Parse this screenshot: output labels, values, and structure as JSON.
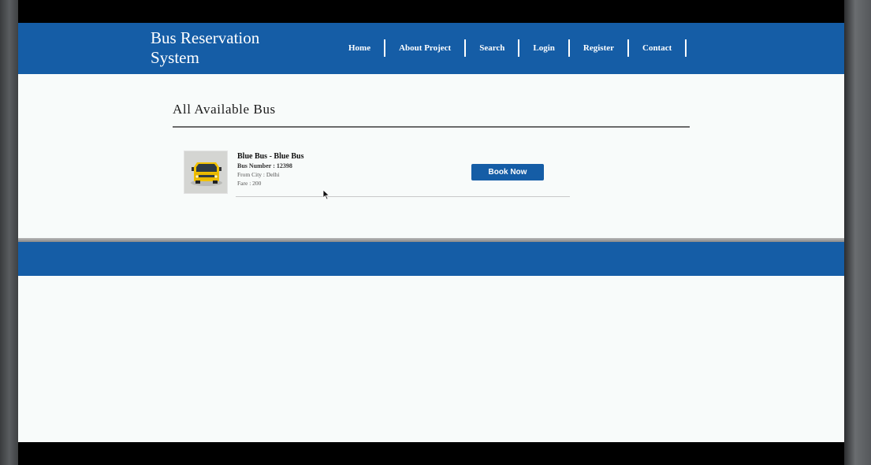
{
  "header": {
    "brand_line1": "Bus Reservation",
    "brand_line2": "System",
    "nav": {
      "home": "Home",
      "about": "About Project",
      "search": "Search",
      "login": "Login",
      "register": "Register",
      "contact": "Contact"
    }
  },
  "main": {
    "title": "All Available Bus",
    "bus": {
      "name": "Blue Bus - Blue Bus",
      "number": "Bus Number : 12398",
      "from": "From City : Delhi",
      "fare": "Fare : 200",
      "book_label": "Book Now"
    }
  },
  "colors": {
    "brand_blue": "#155da6",
    "page_bg": "#f8fbfa"
  }
}
